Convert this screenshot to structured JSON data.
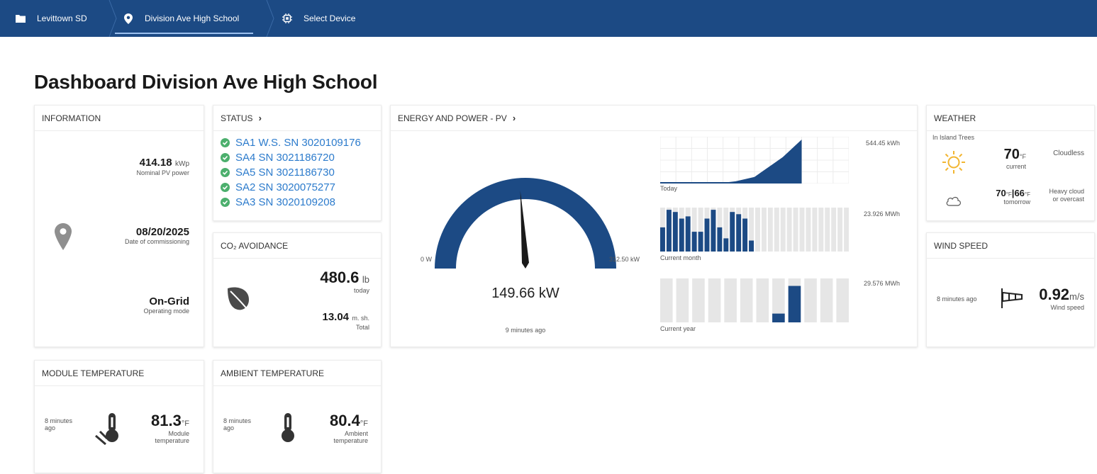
{
  "breadcrumb": {
    "items": [
      {
        "label": "Levittown SD",
        "icon": "folder-icon"
      },
      {
        "label": "Division Ave High School",
        "icon": "location-pin-icon"
      },
      {
        "label": "Select Device",
        "icon": "device-icon"
      }
    ]
  },
  "page": {
    "title": "Dashboard Division Ave High School"
  },
  "information": {
    "header": "INFORMATION",
    "nominal_power_value": "414.18",
    "nominal_power_unit": "kWp",
    "nominal_power_label": "Nominal PV power",
    "commission_date": "08/20/2025",
    "commission_label": "Date of commissioning",
    "operating_mode": "On-Grid",
    "operating_mode_label": "Operating mode"
  },
  "status": {
    "header": "STATUS",
    "items": [
      "SA1 W.S. SN 3020109176",
      "SA4 SN 3021186720",
      "SA5 SN 3021186730",
      "SA2 SN 3020075277",
      "SA3 SN 3020109208"
    ]
  },
  "co2": {
    "header": "CO₂ AVOIDANCE",
    "today_value": "480.6",
    "today_unit": "lb",
    "today_label": "today",
    "total_value": "13.04",
    "total_unit": "m. sh.",
    "total_label": "Total"
  },
  "energy": {
    "header": "ENERGY AND POWER - PV",
    "gauge_min": "0 W",
    "gauge_max": "312.50 kW",
    "gauge_fraction": 0.479,
    "current_power": "149.66 kW",
    "updated": "9 minutes ago",
    "today_label": "Today",
    "today_total": "544.45 kWh",
    "month_label": "Current month",
    "month_total": "23.926 MWh",
    "year_label": "Current year",
    "year_total": "29.576 MWh"
  },
  "chart_data": [
    {
      "type": "bar",
      "title": "Current month",
      "values": [
        0.55,
        0.95,
        0.9,
        0.75,
        0.8,
        0.45,
        0.45,
        0.75,
        0.95,
        0.55,
        0.3,
        0.9,
        0.85,
        0.75,
        0.25,
        0,
        0,
        0,
        0,
        0,
        0,
        0,
        0,
        0,
        0,
        0,
        0,
        0,
        0,
        0
      ],
      "ylim": [
        0,
        1
      ]
    },
    {
      "type": "bar",
      "title": "Current year",
      "values": [
        0,
        0,
        0,
        0,
        0,
        0,
        0,
        0.2,
        0.83,
        0,
        0,
        0
      ],
      "ylim": [
        0,
        1
      ]
    },
    {
      "type": "area",
      "title": "Today",
      "x": [
        0,
        0.3,
        0.4,
        0.5,
        0.55,
        0.6,
        0.65,
        0.7,
        0.75,
        1
      ],
      "values": [
        0,
        0,
        0.05,
        0.15,
        0.3,
        0.45,
        0.6,
        0.8,
        1.0,
        0
      ],
      "ylim": [
        0,
        1
      ]
    }
  ],
  "weather": {
    "header": "WEATHER",
    "location": "In Island Trees",
    "current_temp": "70",
    "temp_unit": "°F",
    "current_label": "current",
    "current_condition": "Cloudless",
    "tomorrow_high": "70",
    "tomorrow_low": "66",
    "tomorrow_label": "tomorrow",
    "tomorrow_condition_line1": "Heavy cloud",
    "tomorrow_condition_line2": "or overcast"
  },
  "wind": {
    "header": "WIND SPEED",
    "updated": "8 minutes ago",
    "value": "0.92",
    "unit": "m/s",
    "label": "Wind speed"
  },
  "module_temp": {
    "header": "MODULE TEMPERATURE",
    "updated_line1": "8 minutes",
    "updated_line2": "ago",
    "value": "81.3",
    "unit": "°F",
    "label_line1": "Module",
    "label_line2": "temperature"
  },
  "ambient_temp": {
    "header": "AMBIENT TEMPERATURE",
    "updated_line1": "8 minutes",
    "updated_line2": "ago",
    "value": "80.4",
    "unit": "°F",
    "label_line1": "Ambient",
    "label_line2": "temperature"
  },
  "colors": {
    "nav_bg": "#1c4a84",
    "accent": "#1c4a84",
    "status_ok": "#4caf6d",
    "link": "#2c7bcc",
    "sun": "#f2b632"
  }
}
